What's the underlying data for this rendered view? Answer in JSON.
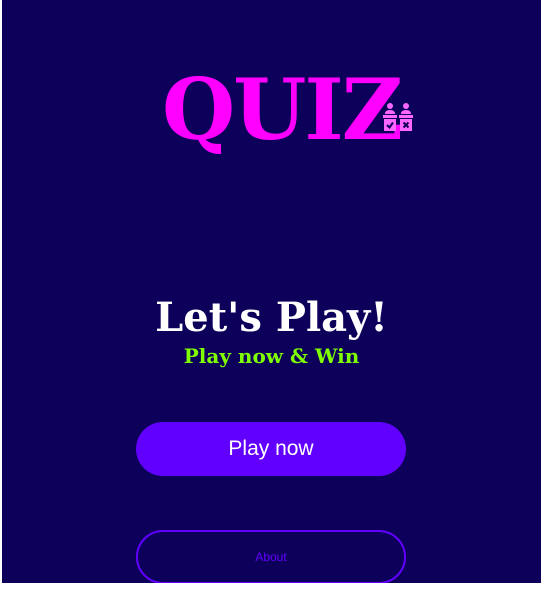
{
  "logo": {
    "text": "QUIZ",
    "icon": "quiz-players-icon",
    "color": "#ff00ff"
  },
  "hero": {
    "title": "Let's Play!",
    "subtitle": "Play now & Win",
    "subtitle_color": "#7fff00"
  },
  "buttons": {
    "play_label": "Play now",
    "about_label": "About",
    "accent": "#6200ff"
  },
  "background_color": "#0c005a"
}
